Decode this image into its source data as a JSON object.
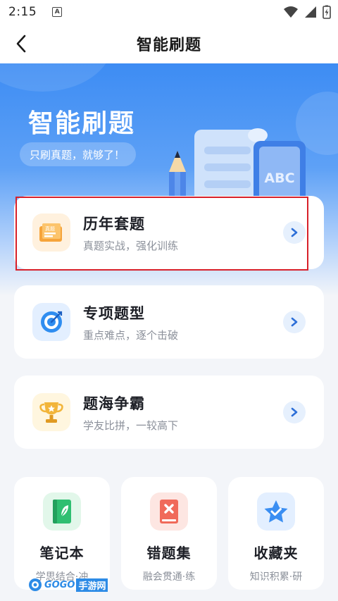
{
  "status_bar": {
    "time": "2:15",
    "notification_letter": "A"
  },
  "nav": {
    "title": "智能刷题"
  },
  "hero": {
    "title": "智能刷题",
    "subtitle": "只刷真题，就够了！",
    "illustration_text": "ABC"
  },
  "cards": [
    {
      "title": "历年套题",
      "subtitle": "真题实战，强化训练",
      "icon": "scroll-icon",
      "icon_label": "真题",
      "accent": "#f6a43a"
    },
    {
      "title": "专项题型",
      "subtitle": "重点难点，逐个击破",
      "icon": "target-icon",
      "accent": "#2f8df0"
    },
    {
      "title": "题海争霸",
      "subtitle": "学友比拼，一较高下",
      "icon": "trophy-icon",
      "accent": "#f2b53a"
    }
  ],
  "tiles": [
    {
      "title": "笔记本",
      "subtitle": "学思结合·冲",
      "icon": "notebook-icon",
      "accent": "#2fbf71"
    },
    {
      "title": "错题集",
      "subtitle": "融会贯通·练",
      "icon": "error-book-icon",
      "accent": "#f06a5a"
    },
    {
      "title": "收藏夹",
      "subtitle": "知识积累·研",
      "icon": "star-icon",
      "accent": "#3a8ef2"
    }
  ],
  "watermark": {
    "brand": "GOGO",
    "suffix": "手游网"
  },
  "colors": {
    "primary": "#3d8cf3",
    "highlight": "#d8202a",
    "background": "#f3f5f9"
  }
}
